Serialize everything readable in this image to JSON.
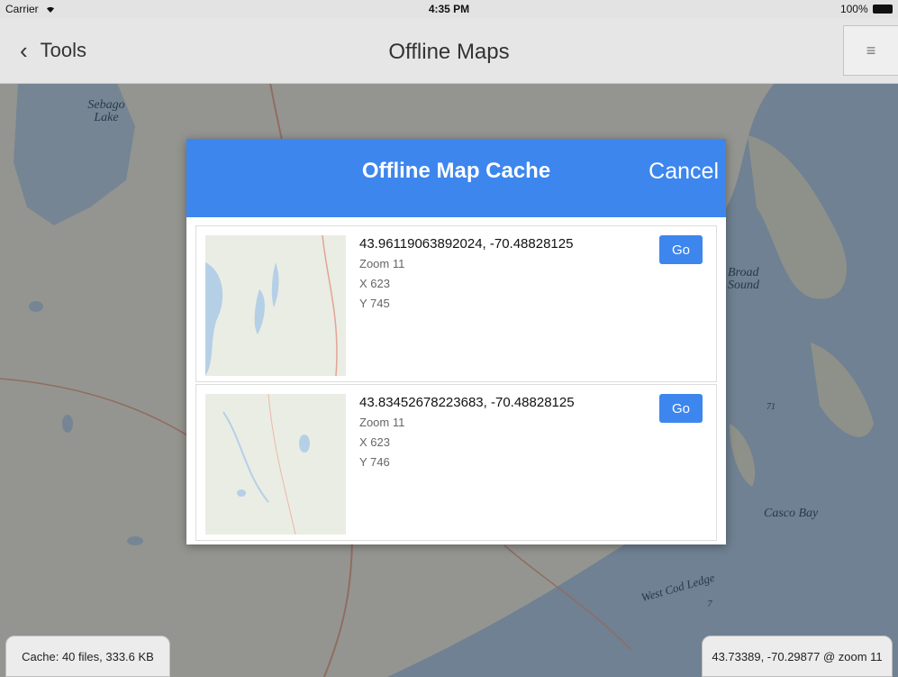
{
  "status_bar": {
    "carrier": "Carrier",
    "wifi_icon": "wifi-icon",
    "time": "4:35 PM",
    "battery": "100%"
  },
  "nav": {
    "back_label": "Tools",
    "back_icon": "chevron-left-icon",
    "title": "Offline Maps",
    "menu_icon": "hamburger-menu-icon"
  },
  "map": {
    "labels": {
      "sebago": "Sebago Lake",
      "broad_sound": "Broad Sound",
      "casco_bay": "Casco Bay",
      "west_cod_ledge": "West Cod Ledge",
      "depth_71": "71",
      "depth_7": "7"
    }
  },
  "modal": {
    "title": "Offline Map Cache",
    "cancel_label": "Cancel",
    "items": [
      {
        "coords": "43.96119063892024, -70.48828125",
        "zoom": "Zoom 11",
        "x": "X 623",
        "y": "Y 745",
        "go_label": "Go"
      },
      {
        "coords": "43.83452678223683, -70.48828125",
        "zoom": "Zoom 11",
        "x": "X 623",
        "y": "Y 746",
        "go_label": "Go"
      }
    ]
  },
  "footer": {
    "cache_info": "Cache: 40 files, 333.6 KB",
    "position_info": "43.73389, -70.29877 @ zoom 11"
  },
  "colors": {
    "accent": "#3d86ee",
    "navbar": "#e6e6e6",
    "water": "#a9c8e6"
  }
}
